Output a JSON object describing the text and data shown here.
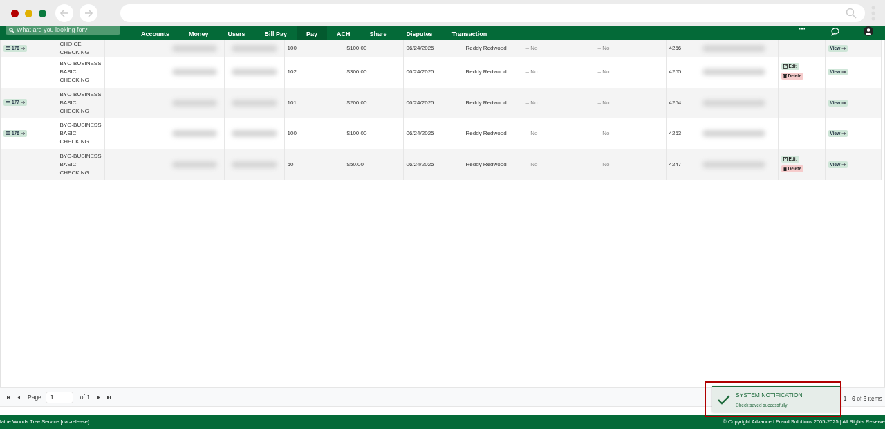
{
  "nav": {
    "search": {
      "placeholder": "What are you looking for?"
    },
    "items": [
      {
        "label": "Accounts",
        "selected": false
      },
      {
        "label": "Money",
        "selected": false
      },
      {
        "label": "Users",
        "selected": false
      },
      {
        "label": "Bill Pay",
        "selected": false
      },
      {
        "label": "Pay",
        "selected": true
      },
      {
        "label": "ACH",
        "selected": false
      },
      {
        "label": "Share",
        "selected": false
      },
      {
        "label": "Disputes",
        "selected": false
      },
      {
        "label": "Transaction",
        "selected": false
      }
    ]
  },
  "table": {
    "rows": [
      {
        "badge": "178",
        "account": "CHOICE CHECKING",
        "check_number": "100",
        "amount": "$100.00",
        "date": "06/24/2025",
        "user": "Reddy Redwood",
        "column_9": "– No",
        "column_10": "– No",
        "column_11": "4256",
        "view": "View"
      },
      {
        "account": "BYO-BUSINESS BASIC CHECKING",
        "check_number": "102",
        "amount": "$300.00",
        "date": "06/24/2025",
        "user": "Reddy Redwood",
        "column_9": "– No",
        "column_10": "– No",
        "column_11": "4255",
        "edit": "Edit",
        "delete": "Delete",
        "view": "View"
      },
      {
        "badge": "177",
        "account": "BYO-BUSINESS BASIC CHECKING",
        "check_number": "101",
        "amount": "$200.00",
        "date": "06/24/2025",
        "user": "Reddy Redwood",
        "column_9": "– No",
        "column_10": "– No",
        "column_11": "4254",
        "view": "View"
      },
      {
        "badge": "176",
        "account": "BYO-BUSINESS BASIC CHECKING",
        "check_number": "100",
        "amount": "$100.00",
        "date": "06/24/2025",
        "user": "Reddy Redwood",
        "column_9": "– No",
        "column_10": "– No",
        "column_11": "4253",
        "view": "View"
      },
      {
        "account": "BYO-BUSINESS BASIC CHECKING",
        "check_number": "50",
        "amount": "$50.00",
        "date": "06/24/2025",
        "user": "Reddy Redwood",
        "column_9": "– No",
        "column_10": "– No",
        "column_11": "4247",
        "edit": "Edit",
        "delete": "Delete",
        "view": "View"
      }
    ]
  },
  "pager": {
    "page_label": "Page",
    "page": "1",
    "of": "of 1",
    "summary": "1 - 6 of 6 items"
  },
  "notification": {
    "title": "SYSTEM NOTIFICATION",
    "message": "Check saved successfully"
  },
  "footer": {
    "left": "laine Woods Tree Service  [uat-release]",
    "right": "© Copyright Advanced Fraud Solutions 2005-2025 | All Rights Reserve"
  }
}
